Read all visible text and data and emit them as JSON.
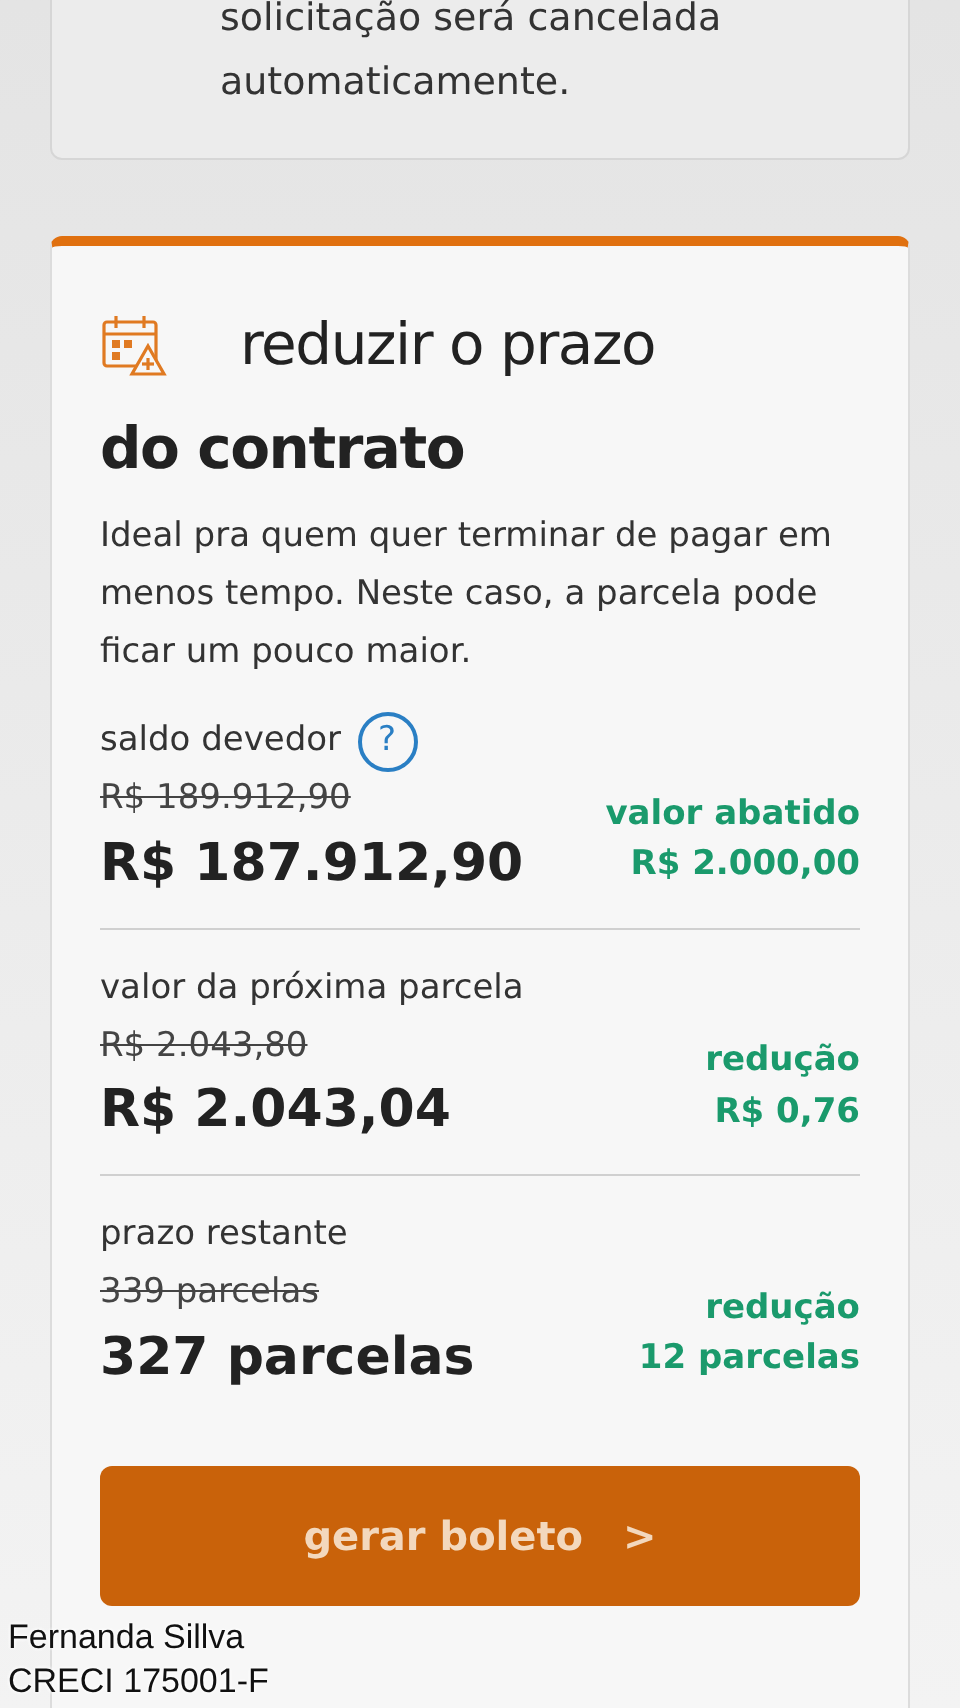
{
  "notice": {
    "lines": [
      "solicitação será cancelada",
      "automaticamente."
    ]
  },
  "option": {
    "title": "reduzir o prazo",
    "title_continued": "do contrato",
    "description": "Ideal pra quem quer terminar de pagar em menos tempo. Neste caso, a parcela pode ficar um pouco maior.",
    "rows": [
      {
        "label": "saldo devedor",
        "help": "?",
        "old_value": "R$ 189.912,90",
        "new_value": "R$ 187.912,90",
        "diff_label": "valor abatido",
        "diff_value": "R$ 2.000,00"
      },
      {
        "label": "valor da próxima parcela",
        "old_value": "R$ 2.043,80",
        "new_value": "R$ 2.043,04",
        "diff_label": "redução",
        "diff_value": "R$ 0,76"
      },
      {
        "label": "prazo restante",
        "old_value": "339 parcelas",
        "new_value": "327 parcelas",
        "diff_label": "redução",
        "diff_value": "12 parcelas"
      }
    ],
    "button": {
      "label": "gerar boleto",
      "icon": ">"
    }
  },
  "caption": {
    "lines": [
      "Fernanda Sillva",
      "CRECI 175001-F"
    ]
  }
}
